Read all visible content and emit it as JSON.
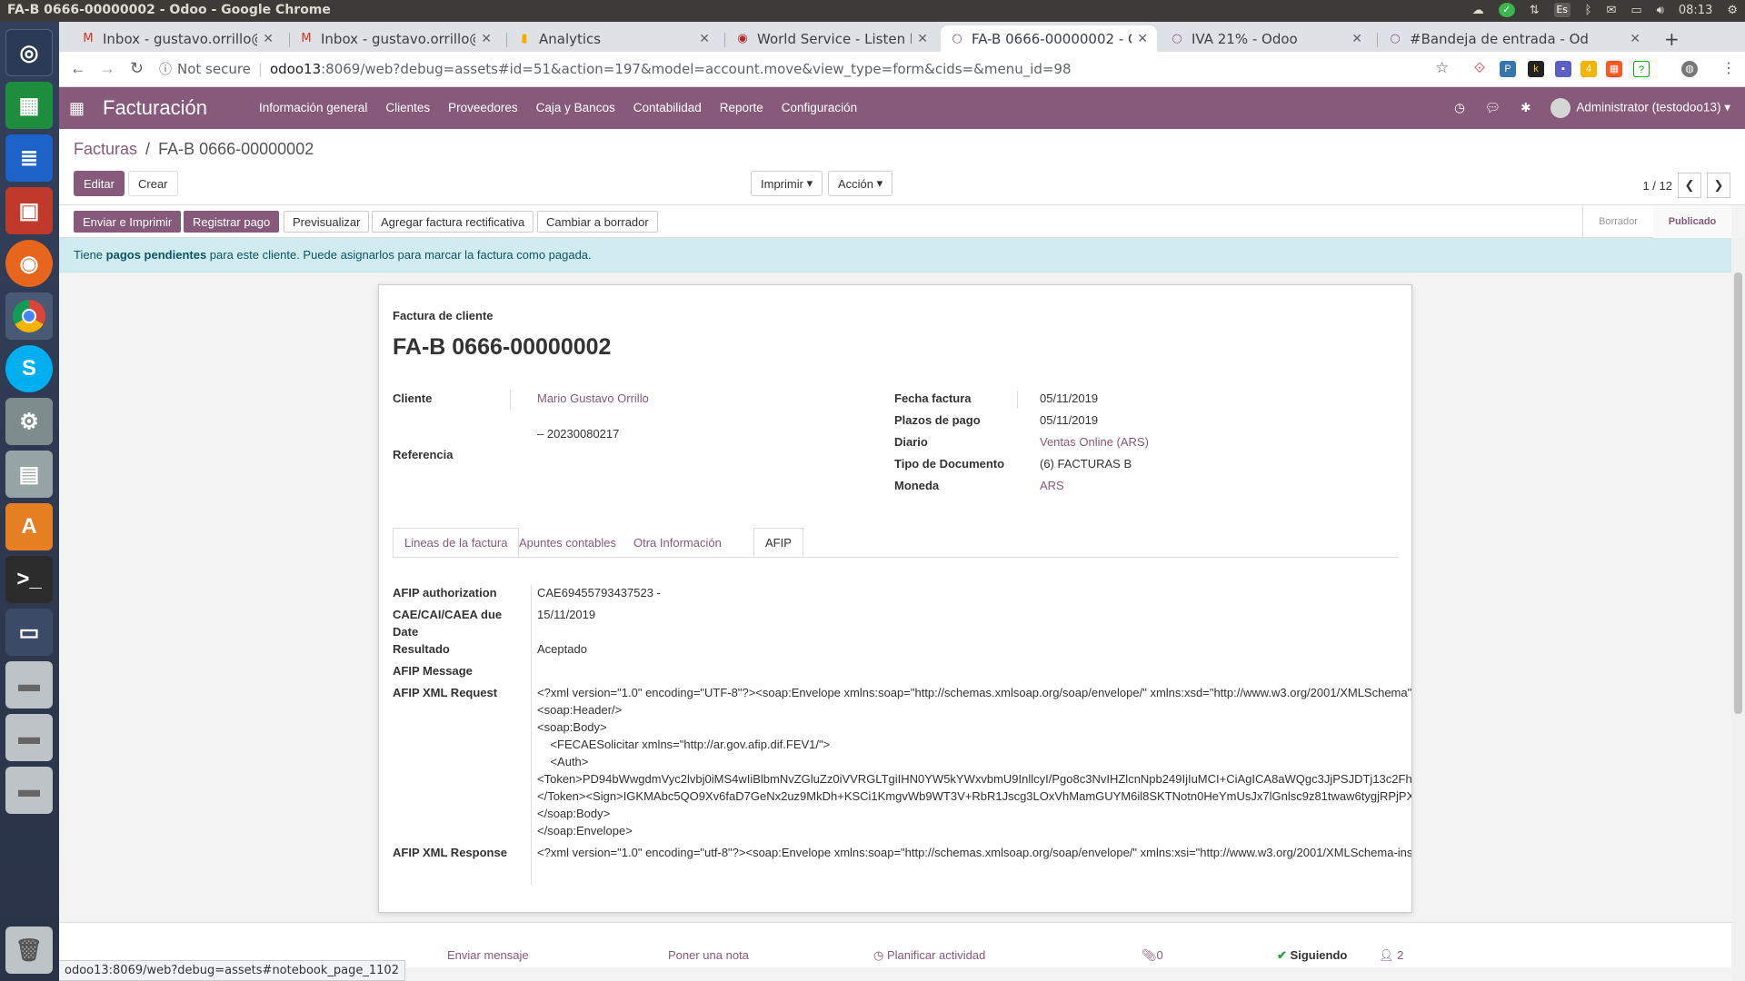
{
  "window": {
    "title": "FA-B 0666-00000002 - Odoo - Google Chrome",
    "clock": "08:13",
    "keyboard": "Es"
  },
  "tabs": [
    {
      "label": "Inbox - gustavo.orrillo@m",
      "icon": "gmail-icon",
      "color": "#d93025"
    },
    {
      "label": "Inbox - gustavo.orrillo@g",
      "icon": "gmail-icon",
      "color": "#d93025"
    },
    {
      "label": "Analytics",
      "icon": "analytics-icon",
      "color": "#f9ab00"
    },
    {
      "label": "World Service - Listen l",
      "icon": "radio-icon",
      "color": "#b1282e"
    },
    {
      "label": "FA-B 0666-00000002 - Odo",
      "icon": "odoo-icon",
      "color": "#875a7b"
    },
    {
      "label": "IVA 21% - Odoo",
      "icon": "odoo-icon",
      "color": "#875a7b"
    },
    {
      "label": "#Bandeja de entrada - Od",
      "icon": "odoo-icon",
      "color": "#875a7b"
    }
  ],
  "address": {
    "security": "Not secure",
    "host": "odoo13",
    "path": ":8069/web?debug=assets#id=51&action=197&model=account.move&view_type=form&cids=&menu_id=98"
  },
  "nav": {
    "brand": "Facturación",
    "menu": [
      "Información general",
      "Clientes",
      "Proveedores",
      "Caja y Bancos",
      "Contabilidad",
      "Reporte",
      "Configuración"
    ],
    "user": "Administrator (testodoo13)"
  },
  "breadcrumb": {
    "parent": "Facturas",
    "separator": "/",
    "current": "FA-B 0666-00000002"
  },
  "control": {
    "edit": "Editar",
    "create": "Crear",
    "print": "Imprimir",
    "action": "Acción",
    "pager": "1 / 12"
  },
  "status_buttons": [
    "Enviar e Imprimir",
    "Registrar pago",
    "Previsualizar",
    "Agregar factura rectificativa",
    "Cambiar a borrador"
  ],
  "stages": {
    "draft": "Borrador",
    "posted": "Publicado"
  },
  "alert": {
    "pre": "Tiene ",
    "bold": "pagos pendientes",
    "post": " para este cliente. Puede asignarlos para marcar la factura como pagada."
  },
  "invoice": {
    "type_label": "Factura de cliente",
    "number": "FA-B 0666-00000002",
    "customer_label": "Cliente",
    "customer": "Mario Gustavo Orrillo",
    "customer_vat": "– 20230080217",
    "reference_label": "Referencia",
    "date_label": "Fecha factura",
    "date": "05/11/2019",
    "terms_label": "Plazos de pago",
    "terms": "05/11/2019",
    "journal_label": "Diario",
    "journal": "Ventas Online (ARS)",
    "doctype_label": "Tipo de Documento",
    "doctype": "(6) FACTURAS B",
    "currency_label": "Moneda",
    "currency": "ARS"
  },
  "notebook": [
    "Lineas de la factura",
    "Apuntes contables",
    "Otra Información",
    "AFIP"
  ],
  "afip": {
    "auth_label": "AFIP authorization",
    "auth": "CAE69455793437523 -",
    "due_label_1": "CAE/CAI/CAEA due",
    "due_label_2": "Date",
    "due": "15/11/2019",
    "result_label": "Resultado",
    "result": "Aceptado",
    "message_label": "AFIP Message",
    "request_label": "AFIP XML Request",
    "request_lines": [
      "<?xml version=\"1.0\" encoding=\"UTF-8\"?><soap:Envelope xmlns:soap=\"http://schemas.xmlsoap.org/soap/envelope/\" xmlns:xsd=\"http://www.w3.org/2001/XMLSchema\"",
      "<soap:Header/>",
      "<soap:Body>",
      "    <FECAESolicitar xmlns=\"http://ar.gov.afip.dif.FEV1/\">",
      "    <Auth>",
      "<Token>PD94bWwgdmVyc2lvbj0iMS4wIiBlbmNvZGluZz0iVVRGLTgiIHN0YW5kYWxvbmU9InllcyI/Pgo8c3NvIHZlcnNpb249IjIuMCI+CiAgICA8aWQgc3JjPSJDTj13c2Fh",
      "</Token><Sign>IGKMAbc5QO9Xv6faD7GeNx2uz9MkDh+KSCi1KmgvWb9WT3V+RbR1Jscg3LOxVhMamGUYM6il8SKTNotn0HeYmUsJx7lGnlsc9z81twaw6tygjRPjPX",
      "</soap:Body>",
      "</soap:Envelope>"
    ],
    "response_label": "AFIP XML Response",
    "response": "<?xml version=\"1.0\" encoding=\"utf-8\"?><soap:Envelope xmlns:soap=\"http://schemas.xmlsoap.org/soap/envelope/\" xmlns:xsi=\"http://www.w3.org/2001/XMLSchema-ins"
  },
  "chatter": {
    "send": "Enviar mensaje",
    "note": "Poner una nota",
    "activity": "Planificar actividad",
    "attachments": "0",
    "following": "Siguiendo",
    "followers": "2"
  },
  "status_url": "odoo13:8069/web?debug=assets#notebook_page_1102",
  "colors": {
    "odoo_primary": "#875a7b",
    "alert_bg": "#d1ecf1",
    "chrome_tabbar": "#dee1e6"
  }
}
